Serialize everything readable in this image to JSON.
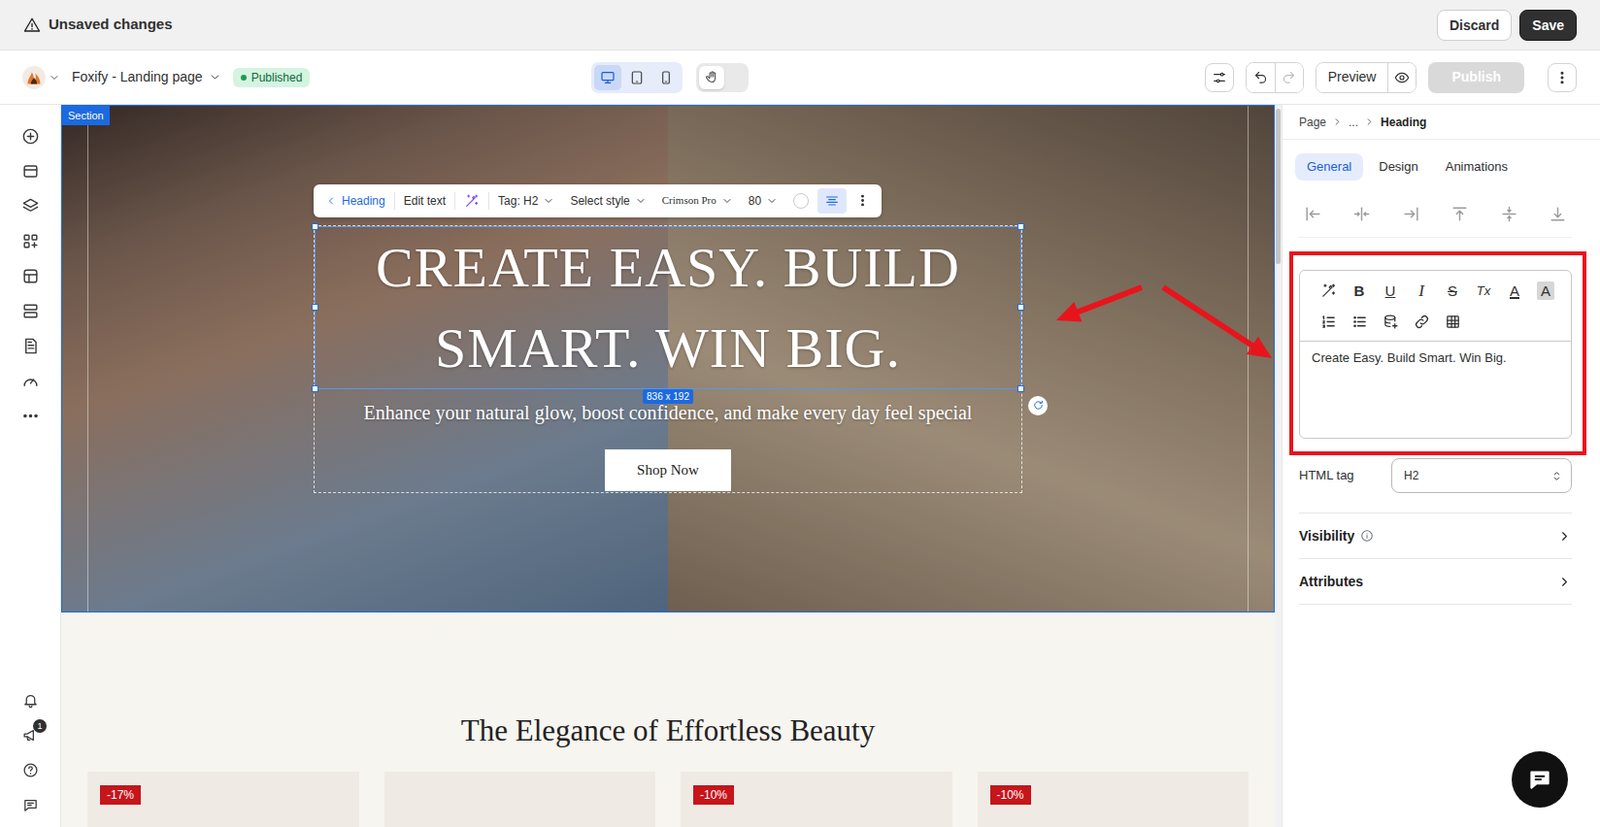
{
  "top_bar": {
    "title": "Unsaved changes",
    "discard": "Discard",
    "save": "Save"
  },
  "header": {
    "page_name": "Foxify - Landing page",
    "status": "Published",
    "devices": [
      {
        "kind": "desktop",
        "selected": true
      },
      {
        "kind": "tablet",
        "selected": false
      },
      {
        "kind": "mobile",
        "selected": false
      }
    ],
    "hand_tool": {
      "on": false
    },
    "undo": {
      "disabled": false
    },
    "redo": {
      "disabled": true
    },
    "preview": "Preview",
    "publish": {
      "label": "Publish",
      "disabled": true
    }
  },
  "sidebar": {
    "items": [
      {
        "kind": "add"
      },
      {
        "kind": "sections"
      },
      {
        "kind": "layers"
      },
      {
        "kind": "apps"
      },
      {
        "kind": "box"
      },
      {
        "kind": "rows"
      },
      {
        "kind": "pages"
      },
      {
        "kind": "speed"
      },
      {
        "kind": "more"
      }
    ],
    "bottom_items": [
      {
        "kind": "bell"
      },
      {
        "kind": "announce",
        "badge": "1"
      },
      {
        "kind": "help"
      },
      {
        "kind": "feedback"
      }
    ]
  },
  "canvas": {
    "section_label": "Section",
    "toolbar": {
      "back": "Heading",
      "edit": "Edit text",
      "tag": "Tag: H2",
      "style": "Select style",
      "font": "Crimson Pro",
      "size": "80",
      "align": {
        "selected": true
      }
    },
    "hero": {
      "heading": "CREATE EASY. BUILD SMART. WIN BIG.",
      "subtitle": "Enhance your natural glow, boost confidence, and make every day feel special",
      "button": "Shop Now",
      "size_tag": "836 x 192"
    },
    "products": {
      "title": "The Elegance of Effortless Beauty",
      "cards": [
        {
          "badge": "-17%"
        },
        {},
        {
          "badge": "-10%"
        },
        {
          "badge": "-10%"
        }
      ]
    }
  },
  "panel": {
    "breadcrumb": [
      "Page",
      "...",
      "Heading"
    ],
    "tabs": [
      {
        "label": "General",
        "selected": true
      },
      {
        "label": "Design",
        "selected": false
      },
      {
        "label": "Animations",
        "selected": false
      }
    ],
    "align_buttons": [
      {
        "kind": "align-left"
      },
      {
        "kind": "align-center"
      },
      {
        "kind": "align-right"
      },
      {
        "kind": "align-top"
      },
      {
        "kind": "align-middle"
      },
      {
        "kind": "align-bottom"
      }
    ],
    "editor": {
      "tool_rows": [
        [
          {
            "kind": "ai"
          },
          {
            "kind": "bold",
            "label": "B"
          },
          {
            "kind": "underline",
            "label": "U"
          },
          {
            "kind": "italic",
            "label": "I"
          },
          {
            "kind": "strike",
            "label": "S"
          },
          {
            "kind": "clear",
            "label": "Tx"
          },
          {
            "kind": "color",
            "label": "A"
          },
          {
            "kind": "highlight",
            "label": "A"
          }
        ],
        [
          {
            "kind": "ordered-list"
          },
          {
            "kind": "bullet-list"
          },
          {
            "kind": "dynamic-data"
          },
          {
            "kind": "link"
          },
          {
            "kind": "table"
          }
        ]
      ],
      "text": "Create Easy. Build Smart. Win Big."
    },
    "html_tag": {
      "label": "HTML tag",
      "value": "H2"
    },
    "sections": [
      {
        "label": "Visibility",
        "info": true
      },
      {
        "label": "Attributes",
        "info": false
      }
    ]
  }
}
